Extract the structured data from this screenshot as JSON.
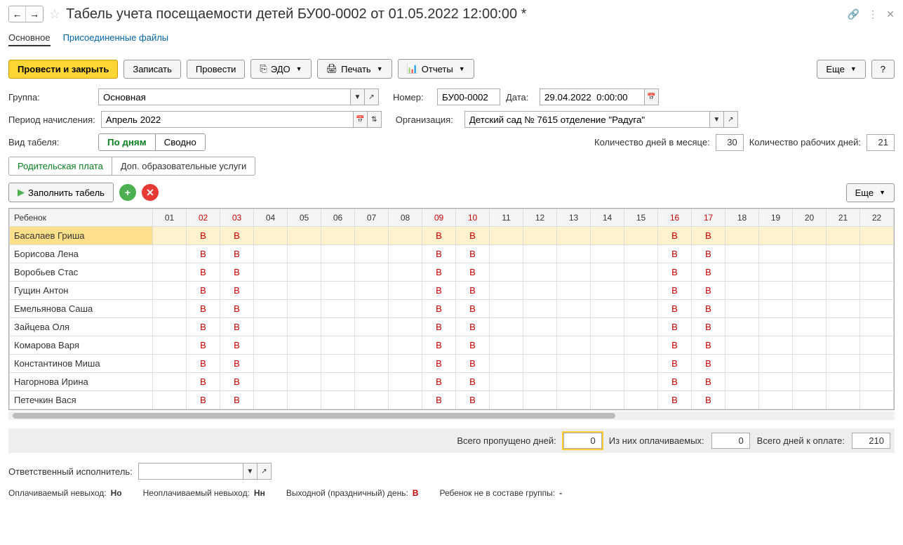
{
  "header": {
    "title": "Табель учета посещаемости детей БУ00-0002 от 01.05.2022 12:00:00 *"
  },
  "subtabs": {
    "main": "Основное",
    "files": "Присоединенные файлы"
  },
  "toolbar": {
    "save_close": "Провести и закрыть",
    "save": "Записать",
    "post": "Провести",
    "edo": "ЭДО",
    "print": "Печать",
    "reports": "Отчеты",
    "more": "Еще"
  },
  "form": {
    "group_label": "Группа:",
    "group_value": "Основная",
    "number_label": "Номер:",
    "number_value": "БУ00-0002",
    "date_label": "Дата:",
    "date_value": "29.04.2022  0:00:00",
    "period_label": "Период начисления:",
    "period_value": "Апрель 2022",
    "org_label": "Организация:",
    "org_value": "Детский сад № 7615 отделение \"Радуга\"",
    "view_label": "Вид табеля:",
    "by_days": "По дням",
    "summary": "Сводно",
    "days_month_label": "Количество дней в месяце:",
    "days_month_value": "30",
    "work_days_label": "Количество рабочих дней:",
    "work_days_value": "21"
  },
  "innerTabs": {
    "parent": "Родительская плата",
    "extra": "Доп. образовательные услуги"
  },
  "fill": {
    "label": "Заполнить табель",
    "more": "Еще"
  },
  "table": {
    "child_header": "Ребенок",
    "days": [
      "01",
      "02",
      "03",
      "04",
      "05",
      "06",
      "07",
      "08",
      "09",
      "10",
      "11",
      "12",
      "13",
      "14",
      "15",
      "16",
      "17",
      "18",
      "19",
      "20",
      "21",
      "22"
    ],
    "red_days": [
      "02",
      "03",
      "09",
      "10",
      "16",
      "17"
    ],
    "rows": [
      {
        "name": "Басалаев Гриша",
        "marks": {
          "02": "В",
          "03": "В",
          "09": "В",
          "10": "В",
          "16": "В",
          "17": "В"
        }
      },
      {
        "name": "Борисова Лена",
        "marks": {
          "02": "В",
          "03": "В",
          "09": "В",
          "10": "В",
          "16": "В",
          "17": "В"
        }
      },
      {
        "name": "Воробьев Стас",
        "marks": {
          "02": "В",
          "03": "В",
          "09": "В",
          "10": "В",
          "16": "В",
          "17": "В"
        }
      },
      {
        "name": "Гущин Антон",
        "marks": {
          "02": "В",
          "03": "В",
          "09": "В",
          "10": "В",
          "16": "В",
          "17": "В"
        }
      },
      {
        "name": "Емельянова Саша",
        "marks": {
          "02": "В",
          "03": "В",
          "09": "В",
          "10": "В",
          "16": "В",
          "17": "В"
        }
      },
      {
        "name": "Зайцева Оля",
        "marks": {
          "02": "В",
          "03": "В",
          "09": "В",
          "10": "В",
          "16": "В",
          "17": "В"
        }
      },
      {
        "name": "Комарова Варя",
        "marks": {
          "02": "В",
          "03": "В",
          "09": "В",
          "10": "В",
          "16": "В",
          "17": "В"
        }
      },
      {
        "name": "Константинов Миша",
        "marks": {
          "02": "В",
          "03": "В",
          "09": "В",
          "10": "В",
          "16": "В",
          "17": "В"
        }
      },
      {
        "name": "Нагорнова Ирина",
        "marks": {
          "02": "В",
          "03": "В",
          "09": "В",
          "10": "В",
          "16": "В",
          "17": "В"
        }
      },
      {
        "name": "Петечкин Вася",
        "marks": {
          "02": "В",
          "03": "В",
          "09": "В",
          "10": "В",
          "16": "В",
          "17": "В"
        }
      }
    ]
  },
  "summary": {
    "missed_label": "Всего пропущено дней:",
    "missed_value": "0",
    "paid_label": "Из них оплачиваемых:",
    "paid_value": "0",
    "total_label": "Всего дней к оплате:",
    "total_value": "210"
  },
  "footer": {
    "resp_label": "Ответственный исполнитель:",
    "resp_value": ""
  },
  "legend": {
    "paid_absence": "Оплачиваемый невыход:",
    "paid_mark": "Но",
    "unpaid_absence": "Неоплачиваемый невыход:",
    "unpaid_mark": "Нн",
    "holiday": "Выходной (праздничный) день:",
    "holiday_mark": "В",
    "not_in_group": "Ребенок не в составе группы:",
    "not_mark": "-"
  }
}
